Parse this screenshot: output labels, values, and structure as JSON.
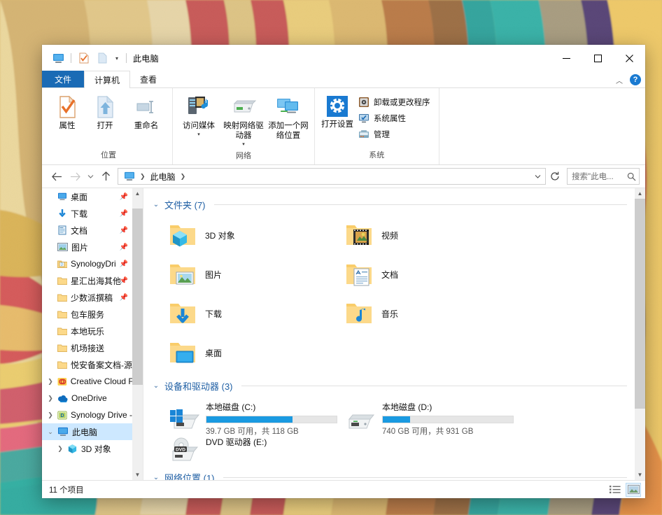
{
  "window": {
    "title": "此电脑",
    "quick_access": [
      "this-pc-icon",
      "properties-icon",
      "new-folder-icon"
    ],
    "dropdown": "customize-quick-access",
    "caption": {
      "minimize": "—",
      "maximize": "☐",
      "close": "✕"
    }
  },
  "tabs": [
    {
      "label": "文件",
      "kind": "file"
    },
    {
      "label": "计算机",
      "kind": "active"
    },
    {
      "label": "查看",
      "kind": "normal"
    }
  ],
  "ribbon": {
    "collapse_icon": "chevron-up-icon",
    "help_icon": "help-icon",
    "groups": [
      {
        "label": "位置",
        "big_buttons": [
          {
            "label": "属性",
            "icon": "properties-icon",
            "has_caret": false
          },
          {
            "label": "打开",
            "icon": "open-icon",
            "has_caret": false
          },
          {
            "label": "重命名",
            "icon": "rename-icon",
            "has_caret": false
          }
        ]
      },
      {
        "label": "网络",
        "big_buttons": [
          {
            "label": "访问媒体",
            "icon": "media-server-icon",
            "has_caret": true
          },
          {
            "label": "映射网络驱动器",
            "icon": "map-network-drive-icon",
            "has_caret": true
          },
          {
            "label": "添加一个网络位置",
            "icon": "add-network-location-icon",
            "has_caret": false
          }
        ]
      },
      {
        "label": "系统",
        "big_buttons": [
          {
            "label": "打开设置",
            "icon": "settings-gear-icon",
            "has_caret": false
          }
        ],
        "small_buttons": [
          {
            "label": "卸载或更改程序",
            "icon": "uninstall-program-icon"
          },
          {
            "label": "系统属性",
            "icon": "system-properties-icon"
          },
          {
            "label": "管理",
            "icon": "manage-icon"
          }
        ]
      }
    ]
  },
  "navbar": {
    "back": "←",
    "forward": "→",
    "recent": "˅",
    "up": "↑",
    "breadcrumbs": [
      {
        "label": "",
        "icon": "this-pc-icon"
      },
      {
        "label": "此电脑",
        "icon": ""
      }
    ],
    "address_chevron": "˅",
    "refresh": "⟳",
    "search": {
      "placeholder": "搜索\"此电...",
      "icon": "search-icon"
    }
  },
  "sidebar": {
    "items": [
      {
        "label": "桌面",
        "icon": "desktop-icon",
        "indent": 1,
        "chevron": "",
        "pinned": true,
        "selected": false
      },
      {
        "label": "下载",
        "icon": "downloads-icon",
        "indent": 1,
        "chevron": "",
        "pinned": true,
        "selected": false
      },
      {
        "label": "文档",
        "icon": "documents-icon",
        "indent": 1,
        "chevron": "",
        "pinned": true,
        "selected": false
      },
      {
        "label": "图片",
        "icon": "pictures-icon",
        "indent": 1,
        "chevron": "",
        "pinned": true,
        "selected": false
      },
      {
        "label": "SynologyDri",
        "icon": "synology-folder-icon",
        "indent": 1,
        "chevron": "",
        "pinned": true,
        "selected": false
      },
      {
        "label": "星汇出海其他",
        "icon": "folder-icon",
        "indent": 1,
        "chevron": "",
        "pinned": true,
        "selected": false
      },
      {
        "label": "少数派撰稿",
        "icon": "folder-icon",
        "indent": 1,
        "chevron": "",
        "pinned": true,
        "selected": false
      },
      {
        "label": "包车服务",
        "icon": "folder-icon",
        "indent": 1,
        "chevron": "",
        "pinned": false,
        "selected": false
      },
      {
        "label": "本地玩乐",
        "icon": "folder-icon",
        "indent": 1,
        "chevron": "",
        "pinned": false,
        "selected": false
      },
      {
        "label": "机场接送",
        "icon": "folder-icon",
        "indent": 1,
        "chevron": "",
        "pinned": false,
        "selected": false
      },
      {
        "label": "悦安备案文档-源",
        "icon": "folder-icon",
        "indent": 1,
        "chevron": "",
        "pinned": false,
        "selected": false
      },
      {
        "label": "Creative Cloud F",
        "icon": "creative-cloud-icon",
        "indent": 0,
        "chevron": "›",
        "pinned": false,
        "selected": false
      },
      {
        "label": "OneDrive",
        "icon": "onedrive-icon",
        "indent": 0,
        "chevron": "›",
        "pinned": false,
        "selected": false
      },
      {
        "label": "Synology Drive -",
        "icon": "synology-drive-icon",
        "indent": 0,
        "chevron": "›",
        "pinned": false,
        "selected": false
      },
      {
        "label": "此电脑",
        "icon": "this-pc-icon",
        "indent": 0,
        "chevron": "˅",
        "pinned": false,
        "selected": true
      },
      {
        "label": "3D 对象",
        "icon": "3d-objects-icon",
        "indent": 1,
        "chevron": "›",
        "pinned": false,
        "selected": false
      }
    ]
  },
  "content": {
    "groups": [
      {
        "title": "文件夹 (7)",
        "chevron": "˅"
      },
      {
        "title": "设备和驱动器 (3)",
        "chevron": "˅"
      },
      {
        "title": "网络位置 (1)",
        "chevron": "˅"
      }
    ],
    "folders": [
      {
        "label": "3D 对象",
        "icon": "3d-objects-folder-icon"
      },
      {
        "label": "视频",
        "icon": "videos-folder-icon"
      },
      {
        "label": "图片",
        "icon": "pictures-folder-icon"
      },
      {
        "label": "文档",
        "icon": "documents-folder-icon"
      },
      {
        "label": "下载",
        "icon": "downloads-folder-icon"
      },
      {
        "label": "音乐",
        "icon": "music-folder-icon"
      },
      {
        "label": "桌面",
        "icon": "desktop-folder-icon"
      }
    ],
    "drives": [
      {
        "label": "本地磁盘 (C:)",
        "icon": "windows-drive-icon",
        "free_text": "39.7 GB 可用，共 118 GB",
        "used_percent": 66,
        "bar_color": "#1a9ae1"
      },
      {
        "label": "本地磁盘 (D:)",
        "icon": "hard-drive-icon",
        "free_text": "740 GB 可用，共 931 GB",
        "used_percent": 21,
        "bar_color": "#1a9ae1"
      },
      {
        "label": "DVD 驱动器 (E:)",
        "icon": "dvd-drive-icon",
        "free_text": "",
        "used_percent": 0,
        "bar_color": "#1a9ae1"
      }
    ]
  },
  "statusbar": {
    "item_count": "11 个项目",
    "views": [
      {
        "name": "details-view-button",
        "active": false
      },
      {
        "name": "large-icons-view-button",
        "active": true
      }
    ]
  },
  "colors": {
    "accent": "#1a6bb5",
    "selection": "#cde8ff",
    "group_title": "#1f5fa4",
    "drive_bar": "#1a9ae1"
  }
}
